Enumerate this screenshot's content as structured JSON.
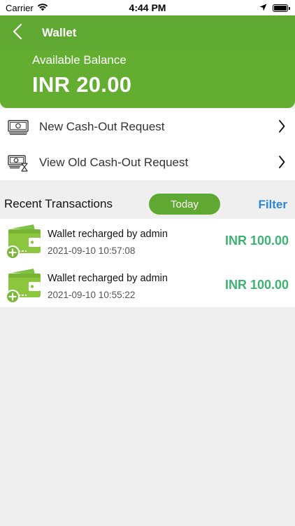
{
  "status_bar": {
    "carrier": "Carrier",
    "time": "4:44 PM"
  },
  "nav": {
    "title": "Wallet"
  },
  "balance": {
    "label": "Available Balance",
    "amount": "INR 20.00"
  },
  "menu": {
    "items": [
      {
        "label": "New Cash-Out Request",
        "icon": "cash-icon"
      },
      {
        "label": "View Old Cash-Out Request",
        "icon": "cash-history-icon"
      }
    ]
  },
  "recent": {
    "title": "Recent Transactions",
    "filter_pill": "Today",
    "filter_link": "Filter"
  },
  "transactions": [
    {
      "title": "Wallet recharged by admin",
      "date": "2021-09-10 10:57:08",
      "amount": "INR 100.00"
    },
    {
      "title": "Wallet recharged by admin",
      "date": "2021-09-10 10:55:22",
      "amount": "INR 100.00"
    }
  ],
  "colors": {
    "brand_green": "#5fa932",
    "amount_green": "#3cb371",
    "link_blue": "#2a86d8"
  }
}
